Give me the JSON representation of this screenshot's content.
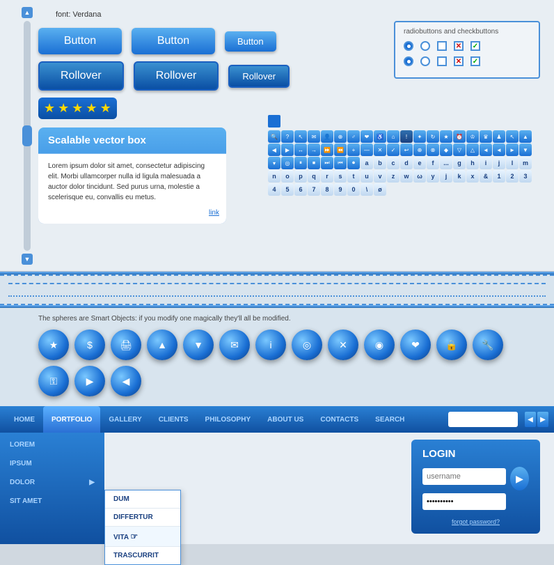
{
  "font_label": "font: Verdana",
  "buttons": {
    "btn1_label": "Button",
    "btn2_label": "Button",
    "btn3_label": "Button",
    "roll1_label": "Rollover",
    "roll2_label": "Rollover",
    "roll3_label": "Rollover"
  },
  "vector_box": {
    "title": "Scalable vector box",
    "body": "Lorem ipsum dolor sit amet, consectetur adipiscing elit. Morbi ullamcorper nulla id ligula malesuada a auctor dolor tincidunt. Sed purus urna, molestie a scelerisque eu, convallis eu metus.",
    "link": "link"
  },
  "radio_checkbox": {
    "title": "radiobuttons and checkbuttons"
  },
  "spheres": {
    "caption": "The spheres are Smart Objects: if you modify one magically they'll all be modified.",
    "items": [
      "★",
      "$",
      "🖨",
      "▲",
      "▼",
      "✉",
      "ℹ",
      "⟳",
      "✖",
      "◉",
      "🔒",
      "🔧",
      "🔒",
      "▶",
      "◀"
    ]
  },
  "nav": {
    "home": "HOME",
    "portfolio": "PORTFOLIO",
    "gallery": "GALLERY",
    "clients": "CLIENTS",
    "philosophy": "PHILOSOPHY",
    "about_us": "ABOUT US",
    "contacts": "CONTACTS",
    "search": "SEARCH",
    "search_placeholder": ""
  },
  "dropdown": {
    "items": [
      {
        "label": "LOREM",
        "has_sub": false
      },
      {
        "label": "IPSUM",
        "has_sub": false
      },
      {
        "label": "DOLOR",
        "has_sub": true
      },
      {
        "label": "SIT AMET",
        "has_sub": false
      }
    ],
    "submenu": [
      {
        "label": "DUM"
      },
      {
        "label": "DIFFERTUR"
      },
      {
        "label": "VITA"
      },
      {
        "label": "TRASCURRIT"
      }
    ]
  },
  "login": {
    "title": "LOGIN",
    "username_placeholder": "username",
    "password_placeholder": "••••••••••",
    "forgot_label": "forgot password?"
  },
  "icons": {
    "rows": [
      [
        "🔍",
        "?",
        "🖱",
        "✉",
        "👤",
        "⊕",
        "♂",
        "❤",
        "♿",
        "🏠",
        "!",
        "✦",
        "↻",
        "★",
        "⏰",
        "♔",
        "♕"
      ],
      [
        "↖",
        "▲",
        "◀",
        "▶",
        "↔",
        "→",
        "⏩",
        "⏪",
        "+",
        "—",
        "✕",
        "✓",
        "↩",
        "⊕",
        "⊗",
        "✦"
      ],
      [
        "◄",
        "◄",
        "◄",
        "▼",
        "▼",
        "◎",
        "⏸",
        "⏹",
        "⏭",
        "⏮",
        "⏺",
        "a",
        "b",
        "c",
        "d",
        "e",
        "f"
      ],
      [
        "g",
        "h",
        "i",
        "j",
        "l",
        "m",
        "n",
        "o",
        "p",
        "q",
        "r",
        "s",
        "t",
        "u",
        "v",
        "z",
        "w"
      ],
      [
        "y",
        "j",
        "k",
        "x",
        "&",
        "1",
        "2",
        "3",
        "4",
        "5",
        "6",
        "7",
        "8",
        "9",
        "0",
        "\\"
      ]
    ]
  }
}
